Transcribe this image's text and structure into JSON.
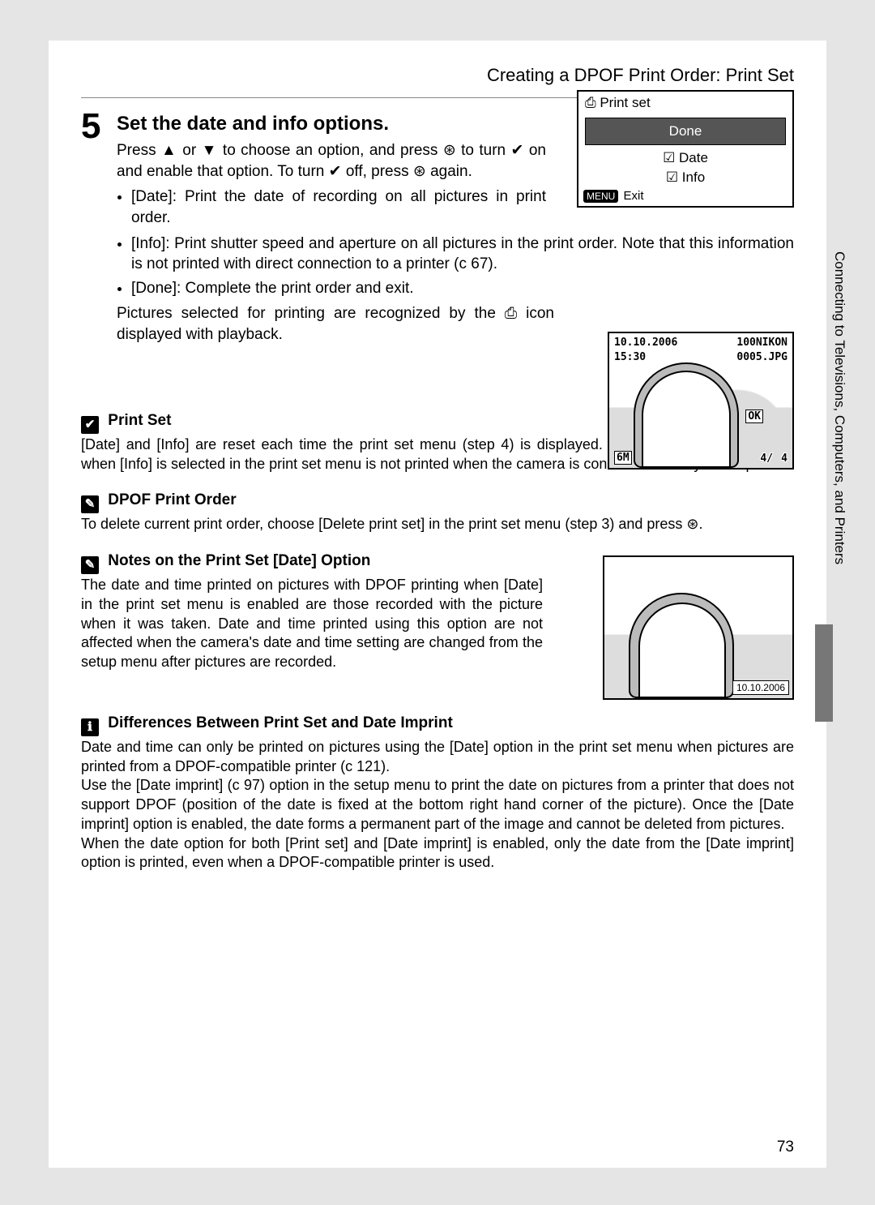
{
  "header": {
    "title": "Creating a DPOF Print Order: Print Set"
  },
  "step": {
    "num": "5",
    "title": "Set the date and info options.",
    "press_line": "Press ▲ or ▼ to choose an option, and press ⊛ to turn ✔ on and enable that option. To turn ✔ off, press ⊛ again.",
    "bullets": {
      "date": "[Date]: Print the date of recording on all pictures in print order.",
      "info": "[Info]: Print shutter speed and aperture on all pictures in the print order. Note that this information is not printed with direct connection to a printer (c 67).",
      "done": "[Done]: Complete the print order and exit."
    },
    "recognized": "Pictures selected for printing are recognized by the ⎙ icon displayed with playback."
  },
  "lcd": {
    "title": "⎙ Print set",
    "done": "Done",
    "date": "☑ Date",
    "info": "☑ Info",
    "menu_badge": "MENU",
    "exit": "Exit"
  },
  "playback": {
    "date": "10.10.2006",
    "time": "15:30",
    "folder": "100NIKON",
    "file": "0005.JPG",
    "ok": "OK",
    "size": "6M",
    "count_a": "4/",
    "count_b": "4"
  },
  "side": {
    "chapter": "Connecting to Televisions, Computers, and Printers"
  },
  "notes": {
    "n1": {
      "title": "Print Set",
      "body": "[Date] and [Info] are reset each time the print set menu (step 4) is displayed. Information normally printed when [Info] is selected in the print set menu is not printed when the camera is connected directly to the printer."
    },
    "n2": {
      "title": "DPOF Print Order",
      "body": "To delete current print order, choose [Delete print set] in the print set menu (step 3) and press ⊛."
    },
    "n3": {
      "title": "Notes on the Print Set [Date] Option",
      "body": "The date and time printed on pictures with DPOF printing when [Date] in the print set menu is enabled are those recorded with the picture when it was taken. Date and time printed using this option are not affected when the camera's date and time setting are changed from the setup menu after pictures are recorded.",
      "image_stamp": "10.10.2006"
    },
    "n4": {
      "title": "Differences Between Print Set and Date Imprint",
      "body1": "Date and time can only be printed on pictures using the [Date] option in the print set menu when pictures are printed from a DPOF-compatible printer (c 121).",
      "body2": "Use the [Date imprint] (c 97) option in the setup menu to print the date on pictures from a printer that does not support DPOF (position of the date is fixed at the bottom right hand corner of the picture). Once the [Date imprint] option is enabled, the date forms a permanent part of the image and cannot be deleted from pictures.",
      "body3": "When the date option for both [Print set] and [Date imprint] is enabled, only the date from the [Date imprint] option is printed, even when a DPOF-compatible printer is used."
    }
  },
  "page_num": "73"
}
